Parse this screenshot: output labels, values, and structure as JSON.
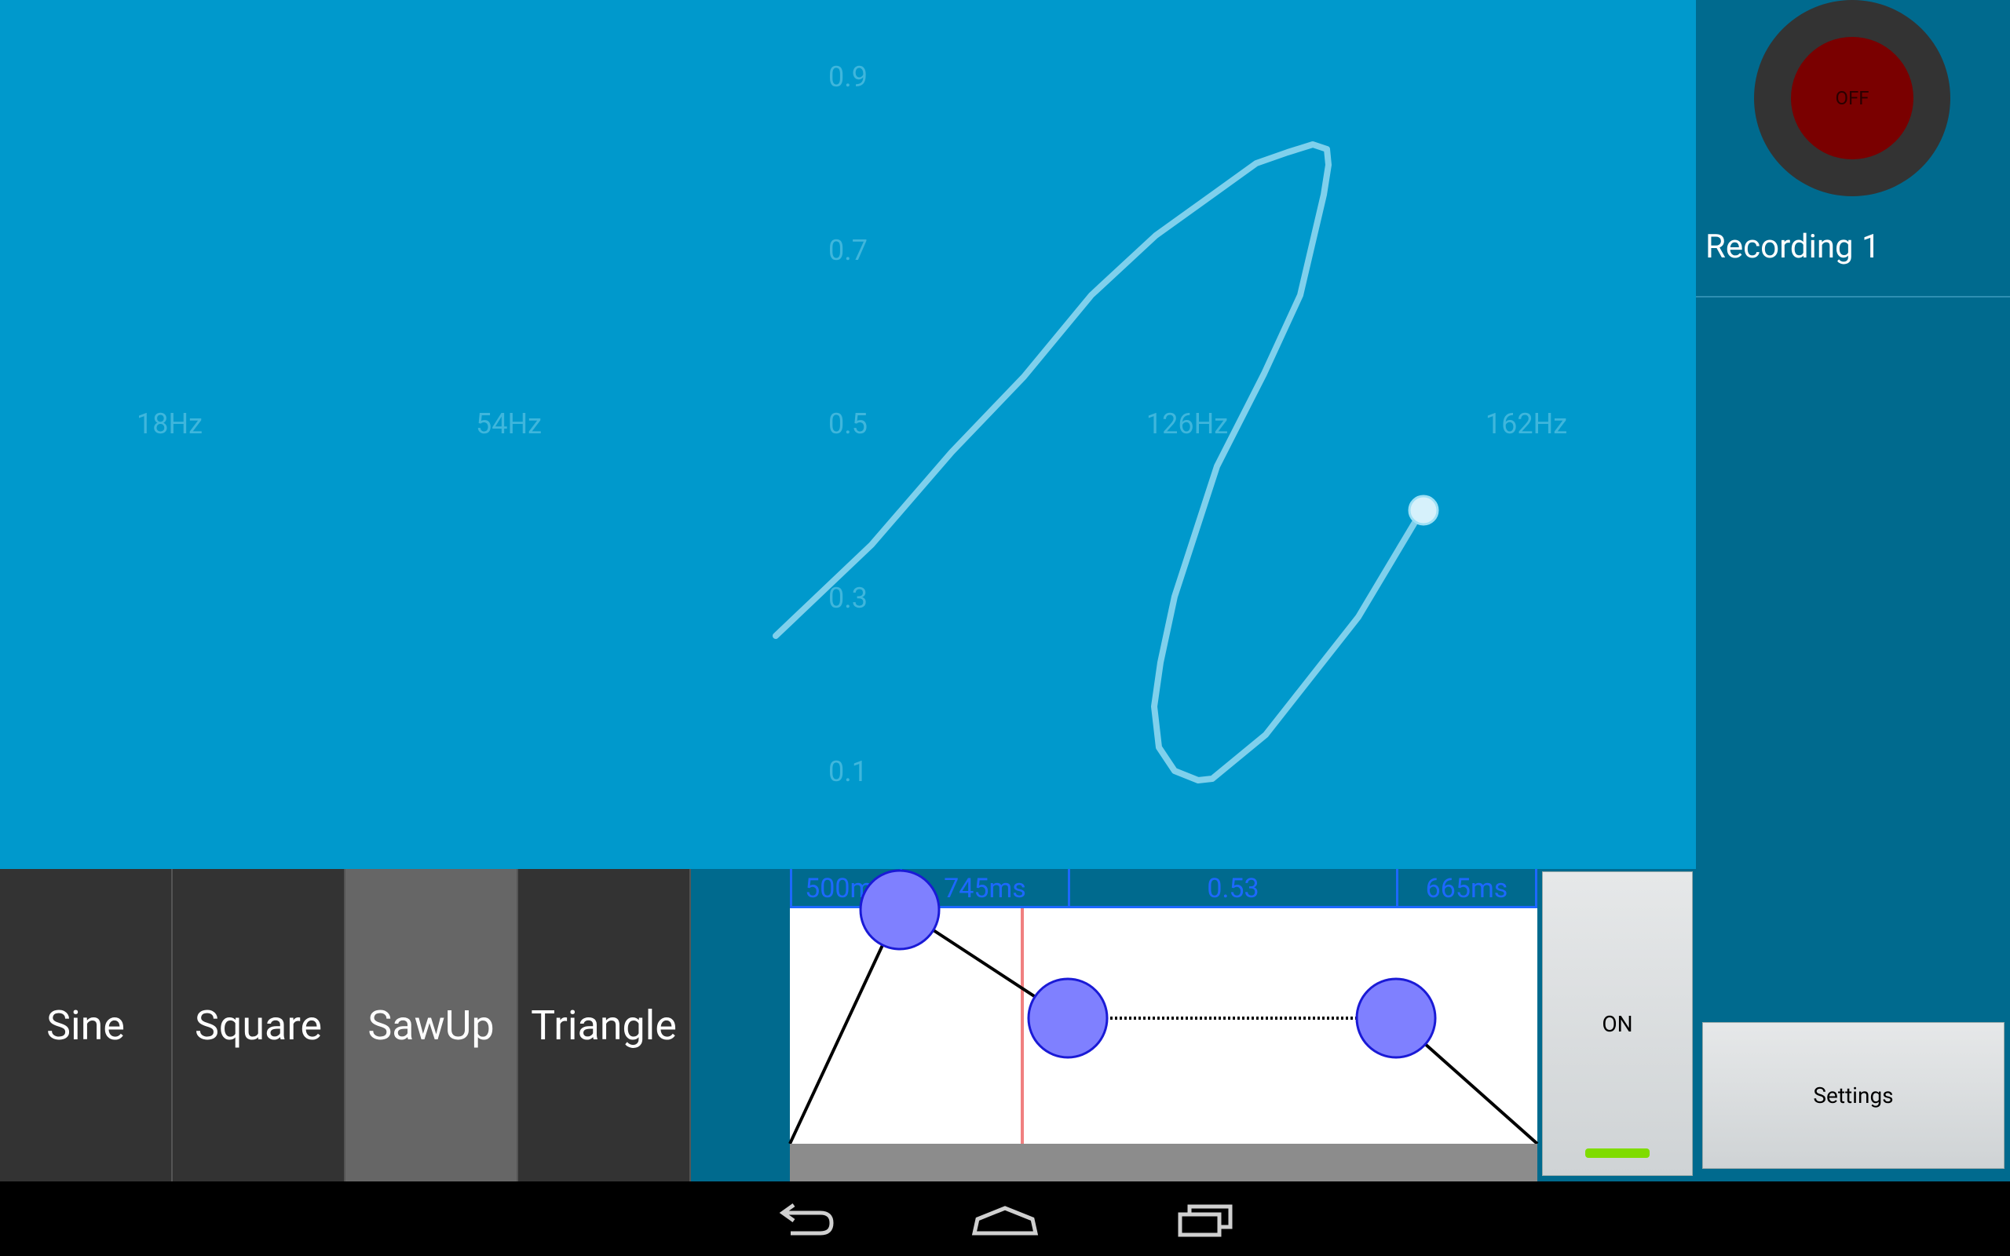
{
  "pad": {
    "x_labels": [
      "18Hz",
      "54Hz",
      "126Hz",
      "162Hz"
    ],
    "y_labels": [
      "0.9",
      "0.7",
      "0.5",
      "0.3",
      "0.1"
    ]
  },
  "recorder": {
    "button_label": "OFF",
    "recording_name": "Recording 1"
  },
  "waveforms": [
    {
      "label": "Sine",
      "selected": false
    },
    {
      "label": "Square",
      "selected": false
    },
    {
      "label": "SawUp",
      "selected": true
    },
    {
      "label": "Triangle",
      "selected": false
    }
  ],
  "envelope": {
    "attack": "500ms",
    "decay": "745ms",
    "sustain": "0.53",
    "release": "665ms"
  },
  "power": {
    "label": "ON"
  },
  "settings": {
    "label": "Settings"
  },
  "navigation": [
    "back-icon",
    "home-icon",
    "recent-apps-icon"
  ],
  "colors": {
    "pad_background": "#0099cc",
    "panel_background": "#006a8e",
    "trace": "#7fd0ec",
    "envelope_point": "#7f80ff",
    "record_button": "#7a0000"
  }
}
